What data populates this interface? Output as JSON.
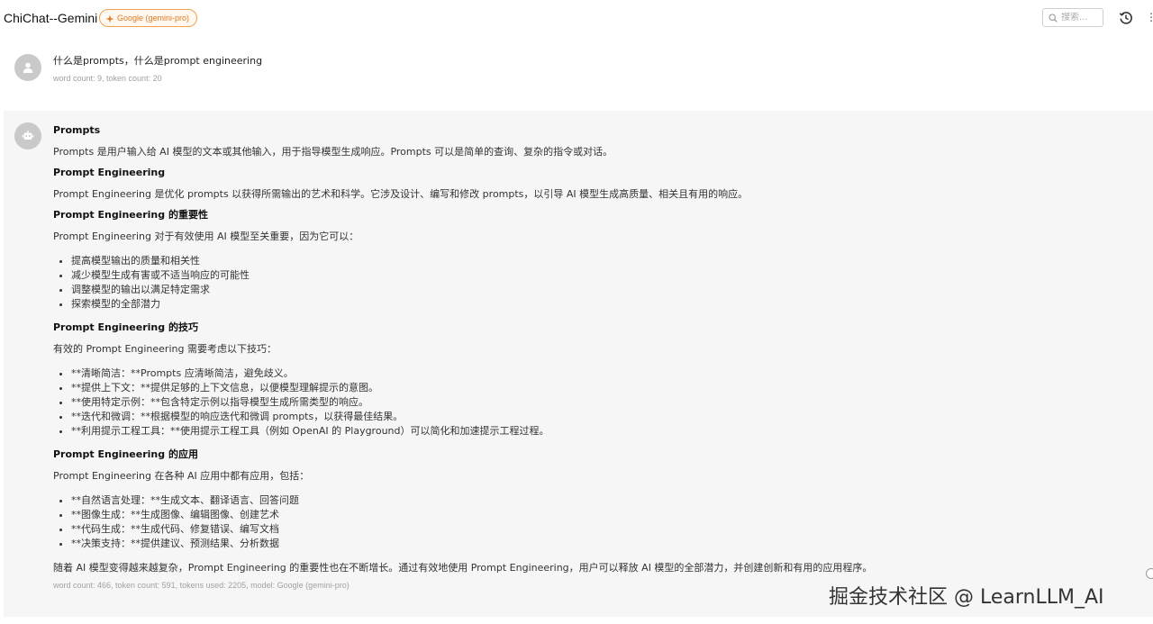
{
  "header": {
    "title": "ChiChat--Gemini",
    "model_badge": "Google (gemini-pro)",
    "search_placeholder": "搜索...",
    "more_label": "⋮"
  },
  "user_message": {
    "text": "什么是prompts，什么是prompt engineering",
    "meta": "word count: 9, token count: 20"
  },
  "bot_message": {
    "h1": "Prompts",
    "p1": "Prompts 是用户输入给 AI 模型的文本或其他输入，用于指导模型生成响应。Prompts 可以是简单的查询、复杂的指令或对话。",
    "h2": "Prompt Engineering",
    "p2": "Prompt Engineering 是优化 prompts 以获得所需输出的艺术和科学。它涉及设计、编写和修改 prompts，以引导 AI 模型生成高质量、相关且有用的响应。",
    "h3": "Prompt Engineering 的重要性",
    "p3": "Prompt Engineering 对于有效使用 AI 模型至关重要，因为它可以：",
    "list1": [
      "提高模型输出的质量和相关性",
      "减少模型生成有害或不适当响应的可能性",
      "调整模型的输出以满足特定需求",
      "探索模型的全部潜力"
    ],
    "h4": "Prompt Engineering 的技巧",
    "p4": "有效的 Prompt Engineering 需要考虑以下技巧：",
    "list2": [
      "**清晰简洁：**Prompts 应清晰简洁，避免歧义。",
      "**提供上下文：**提供足够的上下文信息，以便模型理解提示的意图。",
      "**使用特定示例：**包含特定示例以指导模型生成所需类型的响应。",
      "**迭代和微调：**根据模型的响应迭代和微调 prompts，以获得最佳结果。",
      "**利用提示工程工具：**使用提示工程工具（例如 OpenAI 的 Playground）可以简化和加速提示工程过程。"
    ],
    "h5": "Prompt Engineering 的应用",
    "p5": "Prompt Engineering 在各种 AI 应用中都有应用，包括：",
    "list3": [
      "**自然语言处理：**生成文本、翻译语言、回答问题",
      "**图像生成：**生成图像、编辑图像、创建艺术",
      "**代码生成：**生成代码、修复错误、编写文档",
      "**决策支持：**提供建议、预测结果、分析数据"
    ],
    "p6": "随着 AI 模型变得越来越复杂，Prompt Engineering 的重要性也在不断增长。通过有效地使用 Prompt Engineering，用户可以释放 AI 模型的全部潜力，并创建创新和有用的应用程序。",
    "meta": "word count: 466, token count: 591, tokens used: 2205, model: Google (gemini-pro)"
  },
  "watermark": "掘金技术社区 @ LearnLLM_AI",
  "colors": {
    "badge_orange": "#e07a1e",
    "bot_bg": "#f6f6f6",
    "avatar_gray": "#c9c9c9"
  },
  "icons": {
    "badge": "sparkle-icon",
    "search": "search-icon",
    "history": "history-icon",
    "user_avatar": "user-icon",
    "bot_avatar": "robot-icon"
  }
}
